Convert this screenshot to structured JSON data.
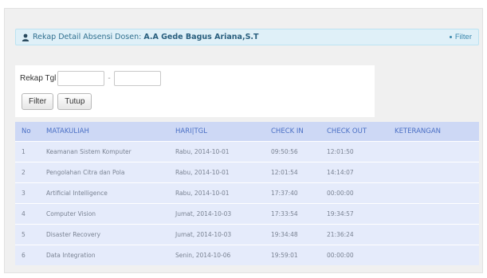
{
  "header": {
    "label": "Rekap Detail Absensi Dosen:",
    "dosen_name": "A.A Gede Bagus Ariana,S.T",
    "filter_link": "Filter",
    "icons": {
      "user": "user-icon",
      "bullet": "bullet-icon"
    }
  },
  "form": {
    "label": "Rekap Tgl",
    "separator": "-",
    "date_from": "",
    "date_to": "",
    "filter_button": "Filter",
    "close_button": "Tutup"
  },
  "table": {
    "columns": [
      "No",
      "MATAKULIAH",
      "HARI|TGL",
      "CHECK IN",
      "CHECK OUT",
      "KETERANGAN"
    ],
    "rows": [
      {
        "no": "1",
        "matakuliah": "Keamanan Sistem Komputer",
        "hari_tgl": "Rabu, 2014-10-01",
        "check_in": "09:50:56",
        "check_out": "12:01:50",
        "keterangan": ""
      },
      {
        "no": "2",
        "matakuliah": "Pengolahan Citra dan Pola",
        "hari_tgl": "Rabu, 2014-10-01",
        "check_in": "12:01:54",
        "check_out": "14:14:07",
        "keterangan": ""
      },
      {
        "no": "3",
        "matakuliah": "Artificial Intelligence",
        "hari_tgl": "Rabu, 2014-10-01",
        "check_in": "17:37:40",
        "check_out": "00:00:00",
        "keterangan": ""
      },
      {
        "no": "4",
        "matakuliah": "Computer Vision",
        "hari_tgl": "Jumat, 2014-10-03",
        "check_in": "17:33:54",
        "check_out": "19:34:57",
        "keterangan": ""
      },
      {
        "no": "5",
        "matakuliah": "Disaster Recovery",
        "hari_tgl": "Jumat, 2014-10-03",
        "check_in": "19:34:48",
        "check_out": "21:36:24",
        "keterangan": ""
      },
      {
        "no": "6",
        "matakuliah": "Data Integration",
        "hari_tgl": "Senin, 2014-10-06",
        "check_in": "19:59:01",
        "check_out": "00:00:00",
        "keterangan": ""
      }
    ]
  },
  "colors": {
    "alert_bg": "#dff0f8",
    "table_header_bg": "#cdd8f5",
    "table_header_text": "#4a6fc4",
    "table_row_bg": "#e5ebfb"
  }
}
